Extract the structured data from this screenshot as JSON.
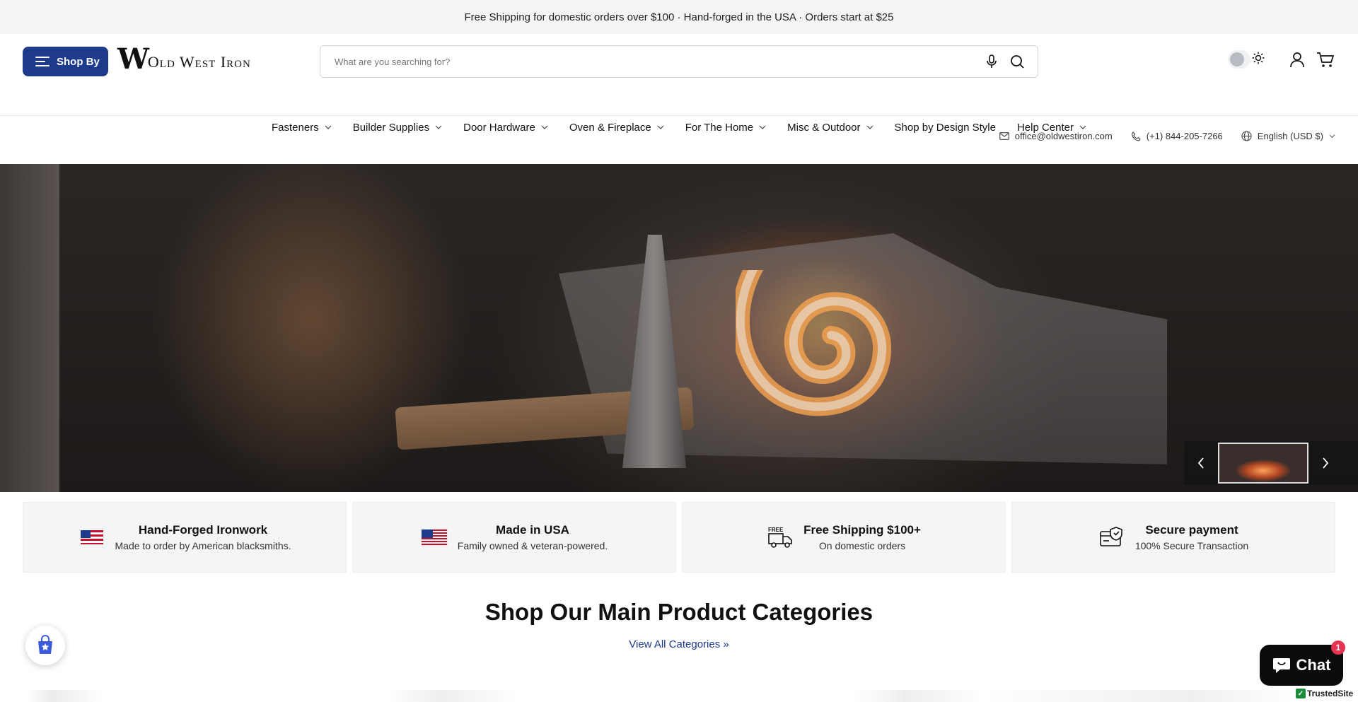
{
  "announcement": "Free Shipping for domestic orders over $100 · Hand-forged in the USA · Orders start at $25",
  "header": {
    "shop_by_label": "Shop By",
    "logo_mark": "W",
    "logo_text": "Old West Iron",
    "search_placeholder": "What are you searching for?"
  },
  "nav": [
    {
      "label": "Fasteners",
      "has_dropdown": true
    },
    {
      "label": "Builder Supplies",
      "has_dropdown": true
    },
    {
      "label": "Door Hardware",
      "has_dropdown": true
    },
    {
      "label": "Oven & Fireplace",
      "has_dropdown": true
    },
    {
      "label": "For The Home",
      "has_dropdown": true
    },
    {
      "label": "Misc & Outdoor",
      "has_dropdown": true
    },
    {
      "label": "Shop by Design Style",
      "has_dropdown": false
    },
    {
      "label": "Help Center",
      "has_dropdown": true
    }
  ],
  "utility": {
    "email": "office@oldwestiron.com",
    "phone": "(+1) 844-205-7266",
    "language": "English (USD $)"
  },
  "features": [
    {
      "title": "Hand-Forged Ironwork",
      "subtitle": "Made to order by American blacksmiths.",
      "icon": "flag-icon"
    },
    {
      "title": "Made in USA",
      "subtitle": "Family owned & veteran-powered.",
      "icon": "us-flag-icon"
    },
    {
      "title": "Free Shipping $100+",
      "subtitle": "On domestic orders",
      "icon": "truck-icon",
      "icon_text": "FREE"
    },
    {
      "title": "Secure payment",
      "subtitle": "100% Secure Transaction",
      "icon": "secure-card-icon"
    }
  ],
  "categories": {
    "title": "Shop Our Main Product Categories",
    "view_all": "View All Categories"
  },
  "chat": {
    "label": "Chat",
    "badge": "1"
  },
  "trusted": "TrustedSite",
  "colors": {
    "accent": "#1e3a8a",
    "chat_bg": "#0b0b0b",
    "badge": "#e53351"
  }
}
